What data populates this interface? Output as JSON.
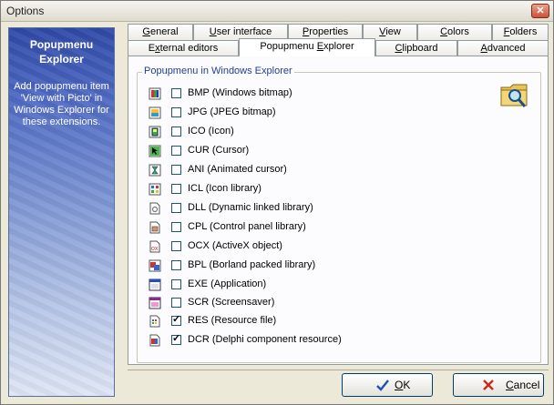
{
  "window": {
    "title": "Options"
  },
  "sidebar": {
    "title": "Popupmenu Explorer",
    "description": "Add popupmenu item 'View with Picto' in Windows Explorer for these extensions."
  },
  "tabs": {
    "row1": [
      {
        "label": "General",
        "u": "G",
        "rest": "eneral"
      },
      {
        "label": "User interface",
        "u": "U",
        "rest": "ser interface"
      },
      {
        "label": "Properties",
        "u": "P",
        "rest": "roperties"
      },
      {
        "label": "View",
        "u": "V",
        "rest": "iew"
      },
      {
        "label": "Colors",
        "u": "C",
        "rest": "olors"
      },
      {
        "label": "Folders",
        "u": "F",
        "rest": "olders"
      }
    ],
    "row2": [
      {
        "label": "External editors",
        "pre": "E",
        "u": "x",
        "rest": "ternal editors"
      },
      {
        "label": "Popupmenu Explorer",
        "pre": "Popupmenu ",
        "u": "E",
        "rest": "xplorer"
      },
      {
        "label": "Clipboard",
        "pre": "",
        "u": "C",
        "rest": "lipboard"
      },
      {
        "label": "Advanced",
        "pre": "",
        "u": "A",
        "rest": "dvanced"
      }
    ],
    "active": "Popupmenu Explorer"
  },
  "group": {
    "label": "Popupmenu in Windows Explorer"
  },
  "extensions": [
    {
      "label": "BMP (Windows bitmap)",
      "checked": false,
      "icon": "bmp-file-icon"
    },
    {
      "label": "JPG (JPEG bitmap)",
      "checked": false,
      "icon": "jpg-file-icon"
    },
    {
      "label": "ICO (Icon)",
      "checked": false,
      "icon": "ico-file-icon"
    },
    {
      "label": "CUR (Cursor)",
      "checked": false,
      "icon": "cur-file-icon"
    },
    {
      "label": "ANI (Animated cursor)",
      "checked": false,
      "icon": "ani-file-icon"
    },
    {
      "label": "ICL (Icon library)",
      "checked": false,
      "icon": "icl-file-icon"
    },
    {
      "label": "DLL (Dynamic linked library)",
      "checked": false,
      "icon": "dll-file-icon"
    },
    {
      "label": "CPL (Control panel library)",
      "checked": false,
      "icon": "cpl-file-icon"
    },
    {
      "label": "OCX (ActiveX object)",
      "checked": false,
      "icon": "ocx-file-icon"
    },
    {
      "label": "BPL (Borland packed library)",
      "checked": false,
      "icon": "bpl-file-icon"
    },
    {
      "label": "EXE (Application)",
      "checked": false,
      "icon": "exe-file-icon"
    },
    {
      "label": "SCR (Screensaver)",
      "checked": false,
      "icon": "scr-file-icon"
    },
    {
      "label": "RES (Resource file)",
      "checked": true,
      "icon": "res-file-icon"
    },
    {
      "label": "DCR (Delphi component resource)",
      "checked": true,
      "icon": "dcr-file-icon"
    }
  ],
  "buttons": {
    "ok": {
      "u": "O",
      "rest": "K"
    },
    "cancel": {
      "u": "C",
      "rest": "ancel"
    }
  },
  "colors": {
    "accent": "#1f3c9b",
    "sidebar_top": "#2f4aa8"
  }
}
